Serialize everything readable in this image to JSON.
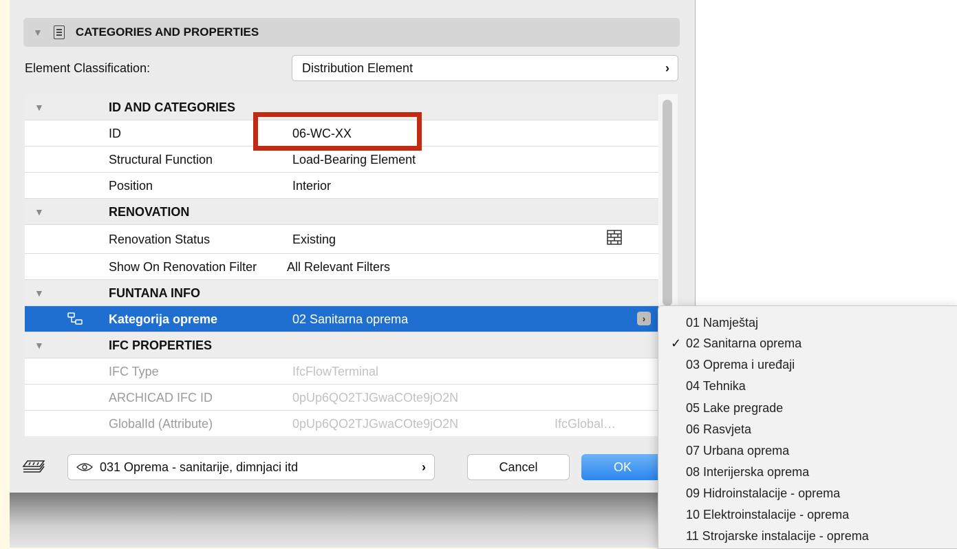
{
  "header": {
    "title": "CATEGORIES AND PROPERTIES"
  },
  "classification": {
    "label": "Element Classification:",
    "value": "Distribution Element"
  },
  "rows": [
    {
      "type": "group",
      "name": "ID AND CATEGORIES"
    },
    {
      "type": "prop",
      "name": "ID",
      "value": "06-WC-XX"
    },
    {
      "type": "prop",
      "name": "Structural Function",
      "value": "Load-Bearing Element"
    },
    {
      "type": "prop",
      "name": "Position",
      "value": "Interior"
    },
    {
      "type": "group",
      "name": "RENOVATION"
    },
    {
      "type": "prop",
      "name": "Renovation Status",
      "value": "Existing"
    },
    {
      "type": "prop",
      "name": "Show On Renovation Filter",
      "value": "All Relevant Filters"
    },
    {
      "type": "group",
      "name": "FUNTANA INFO"
    },
    {
      "type": "prop",
      "name": "Kategorija opreme",
      "value": "02 Sanitarna oprema"
    },
    {
      "type": "group",
      "name": "IFC PROPERTIES"
    },
    {
      "type": "prop",
      "name": "IFC Type",
      "value": "IfcFlowTerminal"
    },
    {
      "type": "prop",
      "name": "ARCHICAD IFC ID",
      "value": "0pUp6QO2TJGwaCOte9jO2N"
    },
    {
      "type": "prop",
      "name": "GlobalId (Attribute)",
      "value": "0pUp6QO2TJGwaCOte9jO2N",
      "extra": "IfcGlobal…"
    }
  ],
  "footer": {
    "layer": "031 Oprema - sanitarije, dimnjaci itd",
    "layer_chevron": "›",
    "cancel": "Cancel",
    "ok": "OK"
  },
  "chevron": "›",
  "dropdown": {
    "selected": "02 Sanitarna oprema",
    "check_mark": "✓",
    "options": [
      "01 Namještaj",
      "02 Sanitarna oprema",
      "03 Oprema i uređaji",
      "04 Tehnika",
      "05 Lake pregrade",
      "06 Rasvjeta",
      "07 Urbana oprema",
      "08 Interijerska oprema",
      "09 Hidroinstalacije - oprema",
      "10 Elektroinstalacije - oprema",
      "11 Strojarske instalacije - oprema"
    ]
  }
}
